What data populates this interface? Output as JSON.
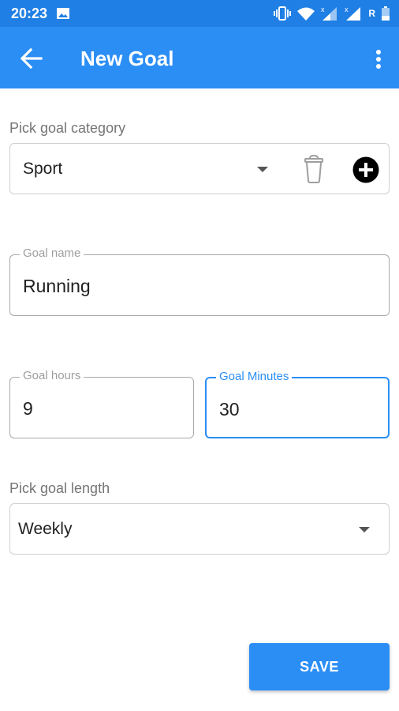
{
  "status_bar": {
    "time": "20:23",
    "network_label": "R",
    "icons": [
      "image-icon",
      "vibrate-icon",
      "wifi-icon",
      "signal-icon",
      "signal-icon",
      "battery-icon"
    ]
  },
  "app_bar": {
    "title": "New Goal",
    "back_icon": "arrow-left-icon",
    "menu_icon": "more-vert-icon"
  },
  "category": {
    "label": "Pick goal category",
    "selected": "Sport",
    "delete_icon": "trash-icon",
    "add_icon": "add-circle-icon"
  },
  "goal_name": {
    "label": "Goal name",
    "value": "Running"
  },
  "goal_hours": {
    "label": "Goal hours",
    "value": "9"
  },
  "goal_minutes": {
    "label": "Goal Minutes",
    "value": "30"
  },
  "length": {
    "label": "Pick goal length",
    "selected": "Weekly"
  },
  "save_label": "SAVE",
  "colors": {
    "primary": "#2b8ef5",
    "status_bar": "#1f7fe4"
  }
}
